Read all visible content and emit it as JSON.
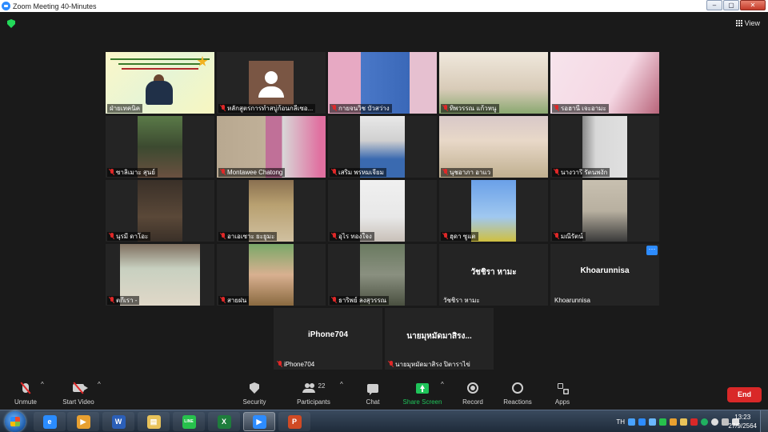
{
  "window": {
    "title": "Zoom Meeting 40-Minutes",
    "controls": [
      "–",
      "▢",
      "✕"
    ]
  },
  "topbar": {
    "view_label": "View"
  },
  "participants": [
    {
      "name": "ฝ่ายเทคนิค",
      "muted": false,
      "video": "banner",
      "active": true
    },
    {
      "name": "หลักสูตรการทำสบู่ก้อนกลีเซอ...",
      "muted": true,
      "video": "avatar"
    },
    {
      "name": "กายจนวิช บัวสว่าง",
      "muted": true,
      "video": "cam"
    },
    {
      "name": "ทิพวรรณ แก้วหนู",
      "muted": true,
      "video": "cam"
    },
    {
      "name": "รอฮานี เจะอามะ",
      "muted": true,
      "video": "cam"
    },
    {
      "name": "ซาลิเมาะ สุนย์",
      "muted": true,
      "video": "cam"
    },
    {
      "name": "Montawee Chatong",
      "muted": true,
      "video": "cam"
    },
    {
      "name": "เสริม พรหมเจียม",
      "muted": true,
      "video": "cam"
    },
    {
      "name": "นุชอาภา อาแว",
      "muted": true,
      "video": "cam"
    },
    {
      "name": "นางวารี รัตนพงัก",
      "muted": true,
      "video": "cam"
    },
    {
      "name": "นุรมี ดาโอะ",
      "muted": true,
      "video": "cam"
    },
    {
      "name": "อาเอเซาะ ยะยูมะ",
      "muted": true,
      "video": "cam"
    },
    {
      "name": "อุไร ทองใจง",
      "muted": true,
      "video": "cam"
    },
    {
      "name": "ฮุดา ซูแต",
      "muted": true,
      "video": "cam"
    },
    {
      "name": "มณีรัตน์",
      "muted": true,
      "video": "cam"
    },
    {
      "name": "ตกีเรา -",
      "muted": true,
      "video": "cam"
    },
    {
      "name": "สายฝน",
      "muted": true,
      "video": "cam"
    },
    {
      "name": "ธาริพย์ ลงสุวรรณ",
      "muted": true,
      "video": "cam"
    },
    {
      "name": "วัชชิรา หามะ",
      "muted": false,
      "video": "none",
      "display": "วัชชิรา หามะ"
    },
    {
      "name": "Khoarunnisa",
      "muted": false,
      "video": "none",
      "display": "Khoarunnisa"
    },
    {
      "name": "iPhone704",
      "muted": true,
      "video": "none",
      "display": "iPhone704"
    },
    {
      "name": "นายมุหมัดมาสิรง ปิตาราไข่",
      "muted": true,
      "video": "none",
      "display": "นายมุหมัดมาสิรง..."
    }
  ],
  "toolbar": {
    "unmute": "Unmute",
    "start_video": "Start Video",
    "security": "Security",
    "participants": "Participants",
    "participants_count": "22",
    "chat": "Chat",
    "share_screen": "Share Screen",
    "record": "Record",
    "reactions": "Reactions",
    "apps": "Apps",
    "end": "End"
  },
  "taskbar": {
    "apps": [
      {
        "name": "internet-explorer",
        "glyph": "e",
        "color": "#2a8cff"
      },
      {
        "name": "media-player",
        "glyph": "▶",
        "color": "#e8a030"
      },
      {
        "name": "word",
        "glyph": "W",
        "color": "#2b5fb8"
      },
      {
        "name": "file-explorer",
        "glyph": "▤",
        "color": "#e8c25a"
      },
      {
        "name": "line",
        "glyph": "LINE",
        "color": "#27c14c"
      },
      {
        "name": "excel",
        "glyph": "X",
        "color": "#1e7d3c"
      },
      {
        "name": "zoom",
        "glyph": "▶",
        "color": "#2d8cff"
      },
      {
        "name": "powerpoint",
        "glyph": "P",
        "color": "#d04a24"
      }
    ],
    "lang": "TH",
    "time": "13:23",
    "date": "27/9/2564"
  },
  "colors": {
    "accent": "#2d8cff",
    "active_speaker": "#e6d200",
    "end_button": "#d92828",
    "share_green": "#1fc45a",
    "muted_red": "#e02828"
  }
}
